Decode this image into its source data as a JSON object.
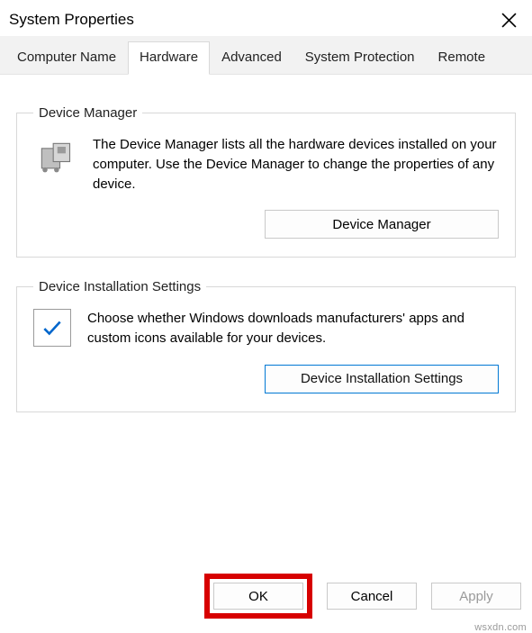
{
  "window": {
    "title": "System Properties"
  },
  "tabs": {
    "computer_name": "Computer Name",
    "hardware": "Hardware",
    "advanced": "Advanced",
    "system_protection": "System Protection",
    "remote": "Remote"
  },
  "device_manager": {
    "legend": "Device Manager",
    "desc": "The Device Manager lists all the hardware devices installed on your computer. Use the Device Manager to change the properties of any device.",
    "button": "Device Manager"
  },
  "install_settings": {
    "legend": "Device Installation Settings",
    "desc": "Choose whether Windows downloads manufacturers' apps and custom icons available for your devices.",
    "button": "Device Installation Settings"
  },
  "buttons": {
    "ok": "OK",
    "cancel": "Cancel",
    "apply": "Apply"
  },
  "watermark": "wsxdn.com"
}
